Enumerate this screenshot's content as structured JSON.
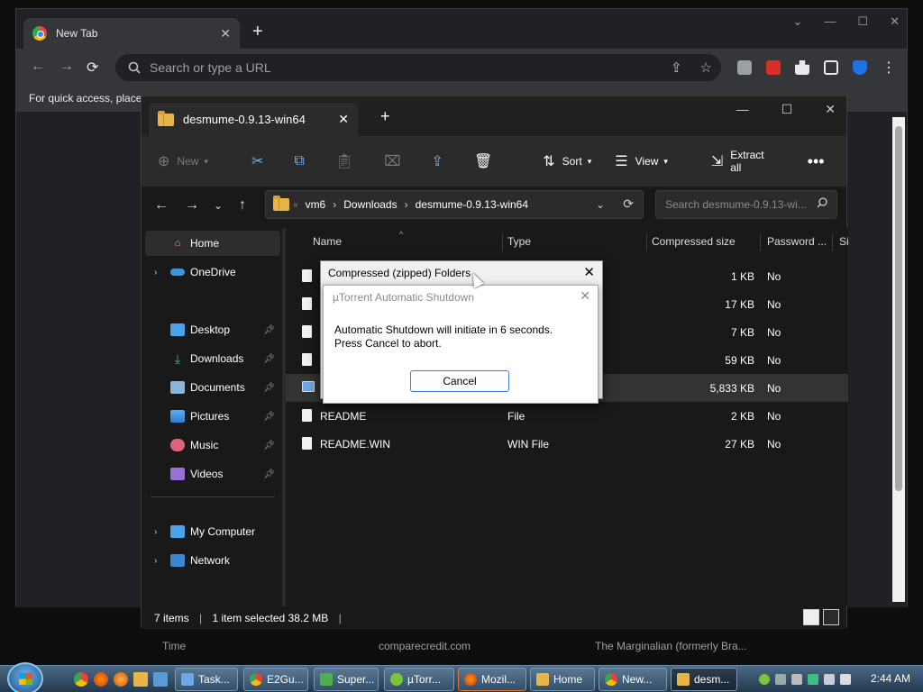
{
  "chrome": {
    "tab_title": "New Tab",
    "omnibox_placeholder": "Search or type a URL",
    "bookmarks_hint": "For quick access, place y",
    "tiles": [
      "Time",
      "comparecredit.com",
      "The Marginalian (formerly Bra..."
    ]
  },
  "explorer": {
    "tab_title": "desmume-0.9.13-win64",
    "toolbar": {
      "new_label": "New",
      "sort_label": "Sort",
      "view_label": "View",
      "extract_label": "Extract all"
    },
    "breadcrumb": [
      "vm6",
      "Downloads",
      "desmume-0.9.13-win64"
    ],
    "search_placeholder": "Search desmume-0.9.13-wi...",
    "nav": {
      "home": "Home",
      "onedrive": "OneDrive",
      "desktop": "Desktop",
      "downloads": "Downloads",
      "documents": "Documents",
      "pictures": "Pictures",
      "music": "Music",
      "videos": "Videos",
      "my_computer": "My Computer",
      "network": "Network"
    },
    "columns": [
      "Name",
      "Type",
      "Compressed size",
      "Password ...",
      "Si"
    ],
    "rows": [
      {
        "name": "",
        "type": "",
        "size": "1 KB",
        "password": "No"
      },
      {
        "name": "",
        "type": "",
        "size": "17 KB",
        "password": "No"
      },
      {
        "name": "",
        "type": "",
        "size": "7 KB",
        "password": "No"
      },
      {
        "name": "",
        "type": "",
        "size": "59 KB",
        "password": "No"
      },
      {
        "name": "",
        "type": "",
        "size": "5,833 KB",
        "password": "No"
      },
      {
        "name": "README",
        "type": "File",
        "size": "2 KB",
        "password": "No"
      },
      {
        "name": "README.WIN",
        "type": "WIN File",
        "size": "27 KB",
        "password": "No"
      }
    ],
    "status": {
      "items": "7 items",
      "selected": "1 item selected  38.2 MB"
    }
  },
  "dialog_zip": {
    "title": "Compressed (zipped) Folders"
  },
  "dialog_utorrent": {
    "title": "µTorrent Automatic Shutdown",
    "line1": "Automatic Shutdown will initiate in 6 seconds.",
    "line2": "Press Cancel to abort.",
    "cancel_label": "Cancel"
  },
  "taskbar": {
    "items": [
      "Task...",
      "E2Gu...",
      "Super...",
      "µTorr...",
      "Mozil...",
      "Home",
      "New...",
      "desm..."
    ],
    "clock": "2:44 AM"
  }
}
